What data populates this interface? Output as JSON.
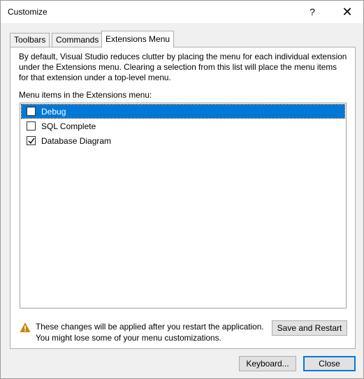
{
  "window": {
    "title": "Customize"
  },
  "titlebar": {
    "help_glyph": "?",
    "close_glyph": "✕"
  },
  "tabs": [
    {
      "label": "Toolbars",
      "active": false
    },
    {
      "label": "Commands",
      "active": false
    },
    {
      "label": "Extensions Menu",
      "active": true
    }
  ],
  "panel": {
    "description": "By default, Visual Studio reduces clutter by placing the menu for each individual extension under the Extensions menu. Clearing a selection from this list will place the menu items for that extension under a top-level menu.",
    "list_label": "Menu items in the Extensions menu:",
    "items": [
      {
        "label": "Debug",
        "checked": false,
        "selected": true
      },
      {
        "label": "SQL Complete",
        "checked": false,
        "selected": false
      },
      {
        "label": "Database Diagram",
        "checked": true,
        "selected": false
      }
    ],
    "warning_text": "These changes will be applied after you restart the application. You might lose some of your menu customizations.",
    "restart_button": "Save and Restart"
  },
  "footer": {
    "keyboard_button": "Keyboard...",
    "close_button": "Close"
  },
  "colors": {
    "selection": "#0078d7",
    "warning": "#c08a00",
    "default_button_border": "#0078d7"
  },
  "icons": {
    "help": "question-mark-icon",
    "close": "close-icon",
    "warning": "warning-triangle-icon",
    "check": "checkmark-icon"
  }
}
